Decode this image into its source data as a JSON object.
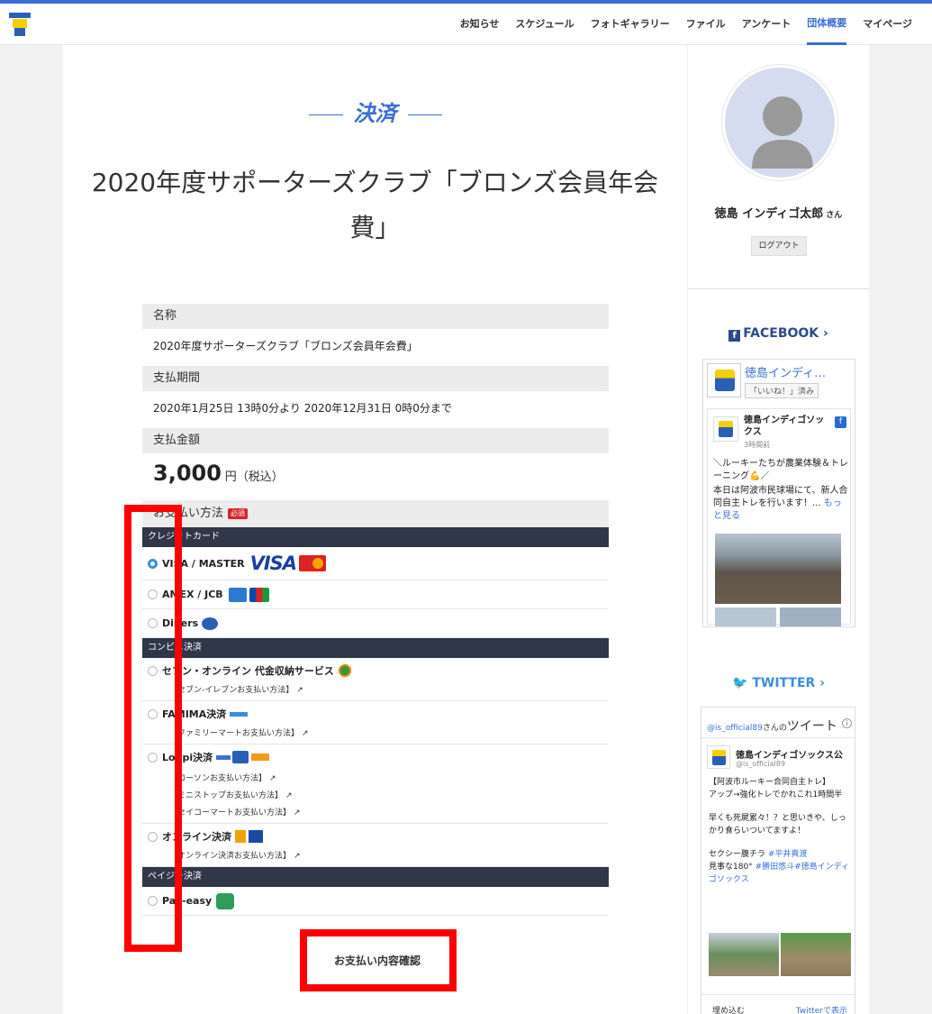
{
  "nav": {
    "items": [
      "お知らせ",
      "スケジュール",
      "フォトギャラリー",
      "ファイル",
      "アンケート",
      "団体概要",
      "マイページ"
    ],
    "active_index": 5
  },
  "section_title": "決済",
  "page_title": "2020年度サポーターズクラブ「ブロンズ会員年会費」",
  "fields": {
    "name_label": "名称",
    "name_value": "2020年度サポーターズクラブ「ブロンズ会員年会費」",
    "period_label": "支払期間",
    "period_value": "2020年1月25日 13時0分より 2020年12月31日 0時0分まで",
    "amount_label": "支払金額",
    "amount_value": "3,000",
    "amount_unit": "円（税込）"
  },
  "payment": {
    "label": "お支払い方法",
    "required": "必須",
    "credit": {
      "category": "クレジットカード",
      "options": [
        "VISA / MASTER",
        "AMEX / JCB",
        "Diners"
      ],
      "visa_text": "VISA",
      "selected_index": 0
    },
    "convenience": {
      "category": "コンビニ決済",
      "seven": {
        "label": "セブン・オンライン 代金収納サービス",
        "link": "【セブン-イレブンお支払い方法】"
      },
      "famima": {
        "label": "FAMIMA決済",
        "link": "【ファミリーマートお支払い方法】"
      },
      "loppi": {
        "label": "Loppi決済",
        "links": [
          "【ローソンお支払い方法】",
          "【ミニストップお支払い方法】",
          "【セイコーマートお支払い方法】"
        ]
      },
      "online": {
        "label": "オンライン決済",
        "link": "【オンライン決済お支払い方法】"
      }
    },
    "payeasy": {
      "category": "ペイジー決済",
      "label": "Pay-easy"
    }
  },
  "confirm_button": "お支払い内容確認",
  "sidebar": {
    "user_name": "徳島 インディゴ太郎",
    "user_suffix": "さん",
    "logout": "ログアウト",
    "facebook": {
      "heading": "FACEBOOK",
      "page_name": "徳島インディ…",
      "liked": "「いいね！」済み",
      "post_author": "徳島インディゴソックス",
      "post_time": "3時間前",
      "post_text": "＼ルーキーたちが農業体験＆トレーニング💪／",
      "post_text2": "本日は阿波市民球場にて、新人合同自主トレを行います！...",
      "more": "もっと見る"
    },
    "twitter": {
      "heading": "TWITTER",
      "account": "@is_official89",
      "account_suffix": "さんの",
      "tweets_word": "ツイート",
      "author": "徳島インディゴソックス公",
      "handle": "@is_official89",
      "text1": "【阿波市ルーキー合同自主トレ】",
      "text2": "アップ→強化トレでかれこれ1時間半",
      "text3": "早くも死屍累々！？と思いきや、しっかり食らいついてますよ！",
      "text4": "セクシー腹チラ",
      "tag1": "#平井真渡",
      "text5": "見事な180°",
      "tag2": "#勝田悠斗#徳島インディゴソックス",
      "embed": "埋め込む",
      "view": "Twitterで表示"
    }
  },
  "colors": {
    "accent": "#3a6fd8",
    "category_bar": "#2f3748",
    "required_badge": "#d8232a",
    "highlight": "#ff0000"
  }
}
